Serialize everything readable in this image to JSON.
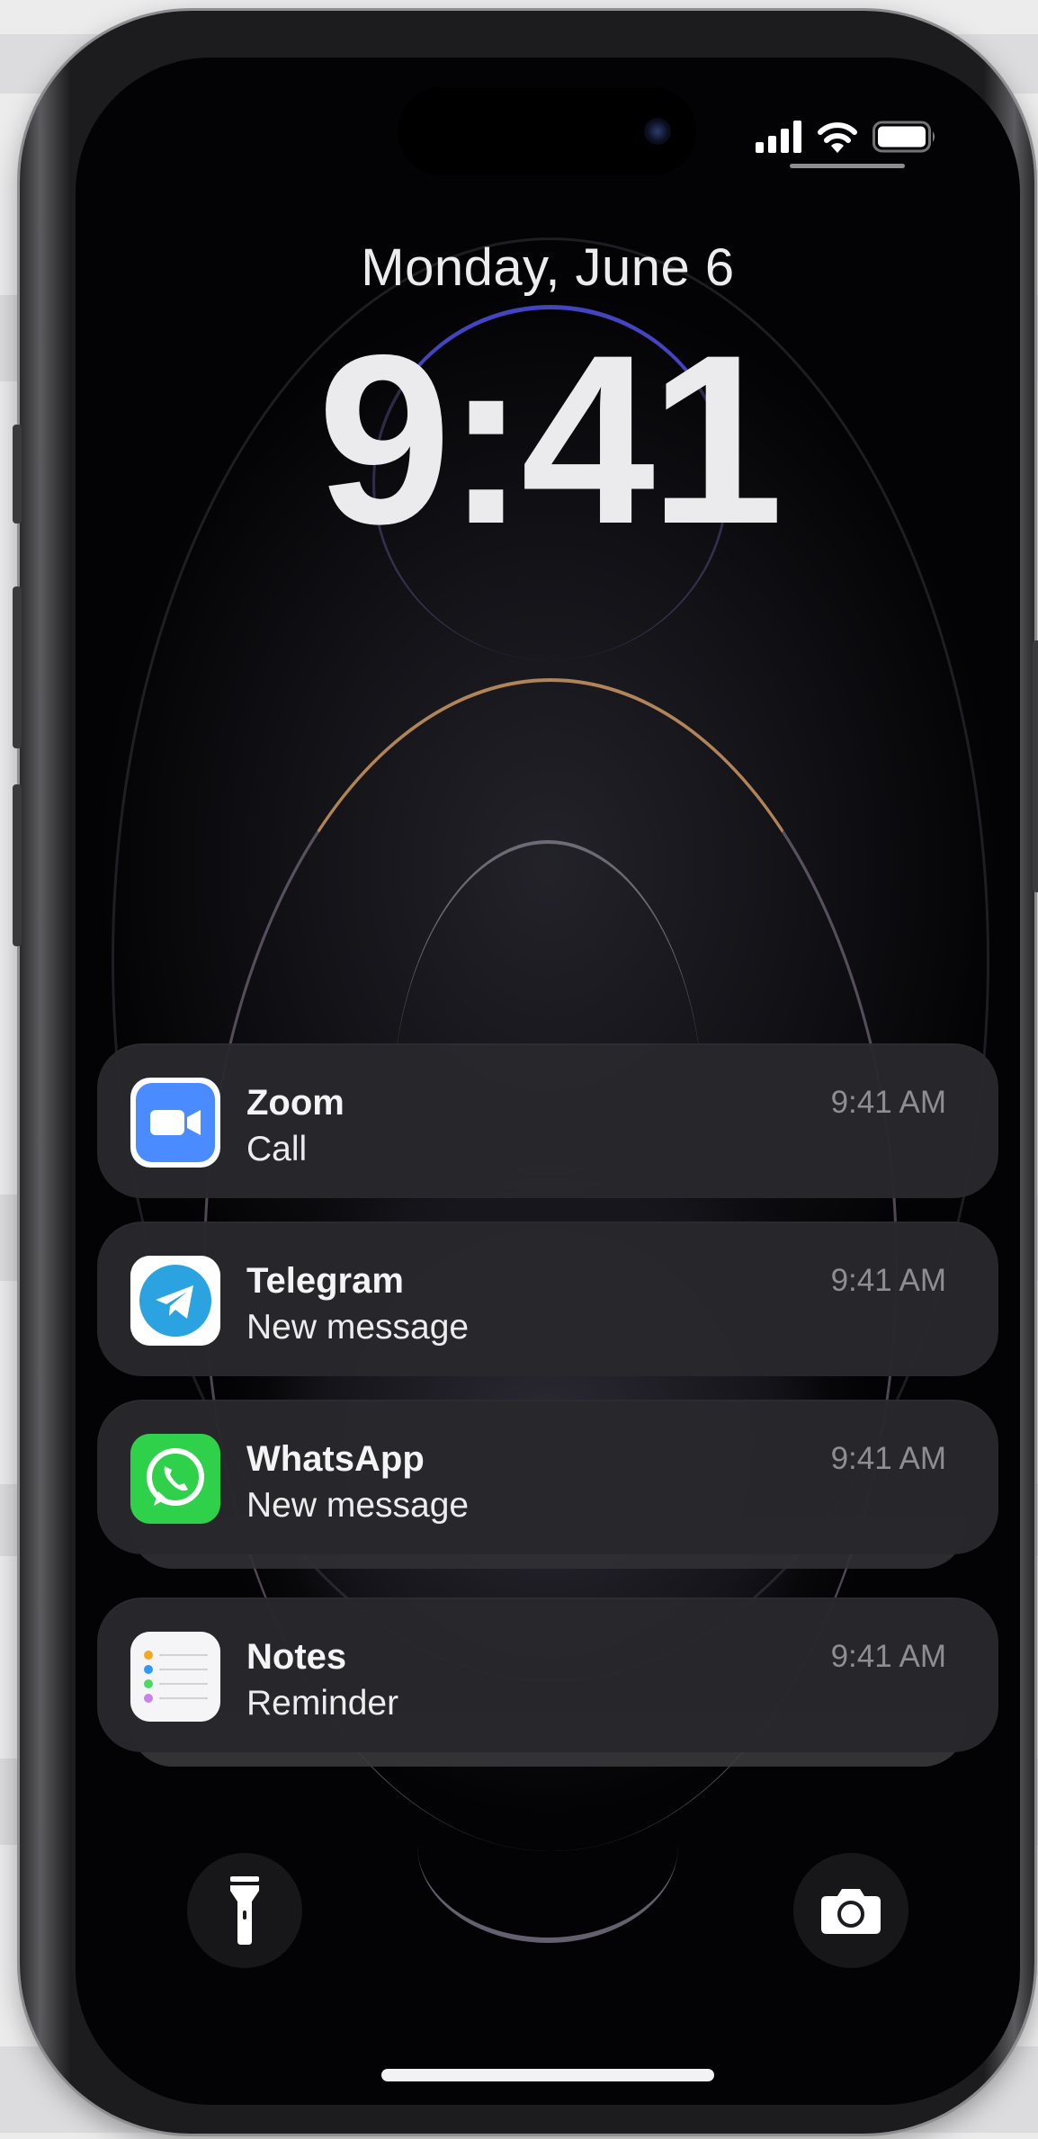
{
  "lock_screen": {
    "date": "Monday, June 6",
    "time": "9:41"
  },
  "status_bar": {
    "icons": [
      "cellular-signal-icon",
      "wifi-icon",
      "battery-icon"
    ]
  },
  "notifications": [
    {
      "app": "Zoom",
      "message": "Call",
      "time": "9:41 AM",
      "icon": "zoom-icon",
      "color": "#4A8CFF"
    },
    {
      "app": "Telegram",
      "message": "New message",
      "time": "9:41 AM",
      "icon": "telegram-icon",
      "color": "#2AA3E0"
    },
    {
      "app": "WhatsApp",
      "message": "New message",
      "time": "9:41 AM",
      "icon": "whatsapp-icon",
      "color": "#2FD14B"
    },
    {
      "app": "Notes",
      "message": "Reminder",
      "time": "9:41 AM",
      "icon": "notes-icon",
      "color": "#F5F5F7"
    }
  ],
  "quick_actions": {
    "left": "flashlight-icon",
    "right": "camera-icon"
  },
  "colors": {
    "frame": "#1c1c1e",
    "notification_bg": "#28282c",
    "secondary_text": "#8d8d92"
  }
}
